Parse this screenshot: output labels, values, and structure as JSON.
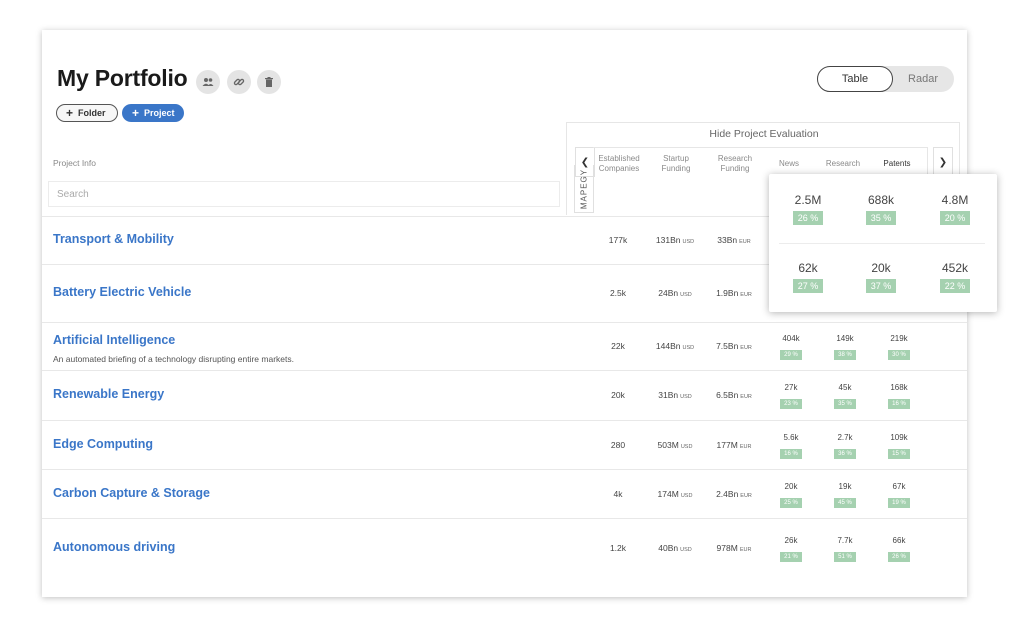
{
  "header": {
    "title": "My Portfolio",
    "icons": [
      "people-icon",
      "link-icon",
      "trash-icon"
    ],
    "folder_label": "Folder",
    "project_label": "Project"
  },
  "view_toggle": {
    "table_label": "Table",
    "radar_label": "Radar",
    "selected": "Table"
  },
  "evaluation": {
    "hide_label": "Hide Project Evaluation",
    "side_label": "MAPEGY",
    "columns": [
      {
        "line1": "Established",
        "line2": "Companies"
      },
      {
        "line1": "Startup",
        "line2": "Funding"
      },
      {
        "line1": "Research",
        "line2": "Funding"
      },
      {
        "line1": "News",
        "line2": ""
      },
      {
        "line1": "Research",
        "line2": ""
      },
      {
        "line1": "Patents",
        "line2": ""
      }
    ]
  },
  "project_info_label": "Project Info",
  "search": {
    "placeholder": "Search"
  },
  "rows": [
    {
      "name": "Transport & Mobility",
      "desc": "",
      "companies": "177k",
      "startup": "131Bn",
      "startup_unit": "USD",
      "research": "33Bn",
      "research_unit": "EUR",
      "news": "",
      "news_pct": "",
      "res": "",
      "res_pct": "",
      "patents": "",
      "patents_pct": ""
    },
    {
      "name": "Battery Electric Vehicle",
      "desc": "",
      "companies": "2.5k",
      "startup": "24Bn",
      "startup_unit": "USD",
      "research": "1.9Bn",
      "research_unit": "EUR",
      "news": "",
      "news_pct": "",
      "res": "",
      "res_pct": "",
      "patents": "",
      "patents_pct": ""
    },
    {
      "name": "Artificial Intelligence",
      "desc": "An automated briefing of a technology disrupting entire markets.",
      "companies": "22k",
      "startup": "144Bn",
      "startup_unit": "USD",
      "research": "7.5Bn",
      "research_unit": "EUR",
      "news": "404k",
      "news_pct": "29 %",
      "res": "149k",
      "res_pct": "38 %",
      "patents": "219k",
      "patents_pct": "30 %"
    },
    {
      "name": "Renewable Energy",
      "desc": "",
      "companies": "20k",
      "startup": "31Bn",
      "startup_unit": "USD",
      "research": "6.5Bn",
      "research_unit": "EUR",
      "news": "27k",
      "news_pct": "23 %",
      "res": "45k",
      "res_pct": "35 %",
      "patents": "168k",
      "patents_pct": "16 %"
    },
    {
      "name": "Edge Computing",
      "desc": "",
      "companies": "280",
      "startup": "503M",
      "startup_unit": "USD",
      "research": "177M",
      "research_unit": "EUR",
      "news": "5.6k",
      "news_pct": "16 %",
      "res": "2.7k",
      "res_pct": "36 %",
      "patents": "109k",
      "patents_pct": "15 %"
    },
    {
      "name": "Carbon Capture & Storage",
      "desc": "",
      "companies": "4k",
      "startup": "174M",
      "startup_unit": "USD",
      "research": "2.4Bn",
      "research_unit": "EUR",
      "news": "20k",
      "news_pct": "25 %",
      "res": "19k",
      "res_pct": "45 %",
      "patents": "67k",
      "patents_pct": "19 %"
    },
    {
      "name": "Autonomous driving",
      "desc": "",
      "companies": "1.2k",
      "startup": "40Bn",
      "startup_unit": "USD",
      "research": "978M",
      "research_unit": "EUR",
      "news": "26k",
      "news_pct": "21 %",
      "res": "7.7k",
      "res_pct": "51 %",
      "patents": "66k",
      "patents_pct": "26 %"
    }
  ],
  "popup": [
    {
      "value": "2.5M",
      "pct": "26 %"
    },
    {
      "value": "688k",
      "pct": "35 %"
    },
    {
      "value": "4.8M",
      "pct": "20 %"
    },
    {
      "value": "62k",
      "pct": "27 %"
    },
    {
      "value": "20k",
      "pct": "37 %"
    },
    {
      "value": "452k",
      "pct": "22 %"
    }
  ]
}
